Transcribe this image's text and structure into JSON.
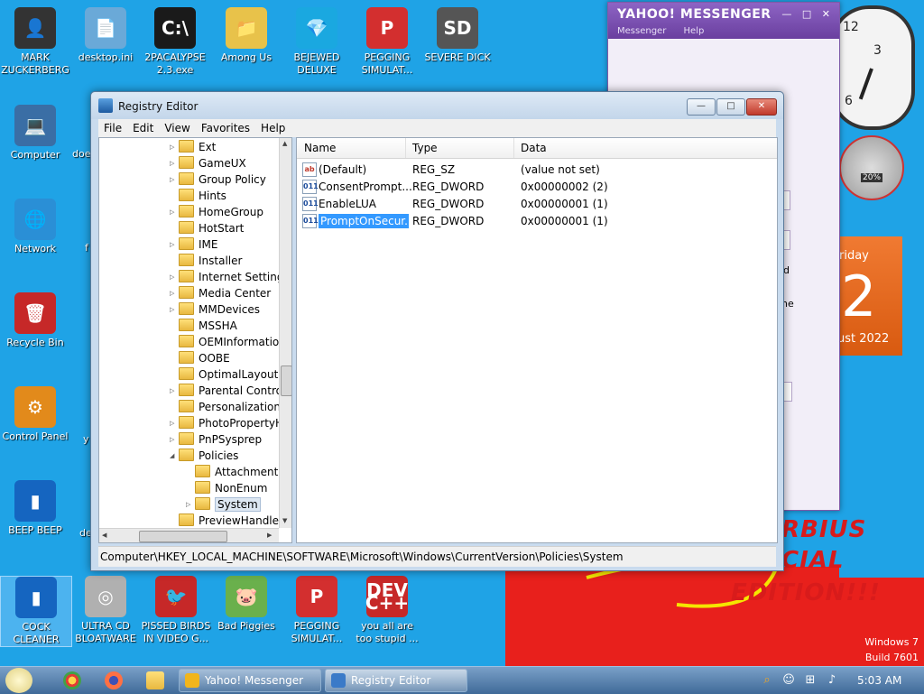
{
  "desktop": {
    "icons_left": [
      {
        "label": "MARK ZUCKERBERG",
        "glyph": "👤",
        "color": "#333333"
      },
      {
        "label": "Computer",
        "glyph": "💻",
        "color": "#3a6ea5"
      },
      {
        "label": "Network",
        "glyph": "🌐",
        "color": "#2a8fd6"
      },
      {
        "label": "Recycle Bin",
        "glyph": "🗑",
        "color": "#c62828"
      },
      {
        "label": "Control Panel",
        "glyph": "⚙",
        "color": "#e28a1b"
      },
      {
        "label": "BEEP BEEP",
        "glyph": "▮",
        "color": "#1565c0"
      },
      {
        "label": "COCK CLEANER",
        "glyph": "▮",
        "color": "#1565c0"
      }
    ],
    "icons_top": [
      {
        "label": "desktop.ini",
        "glyph": "📄",
        "color": "#6aa9d8"
      },
      {
        "label": "2PACALYPSE 2.3.exe",
        "glyph": "C:\\",
        "color": "#1a1a1a"
      },
      {
        "label": "Among Us",
        "glyph": "📁",
        "color": "#e8c24a"
      },
      {
        "label": "BEJEWED DELUXE",
        "glyph": "💎",
        "color": "#1aa8e0"
      },
      {
        "label": "PEGGING SIMULAT...",
        "glyph": "P",
        "color": "#d32f2f"
      },
      {
        "label": "SEVERE DICK",
        "glyph": "SD",
        "color": "#555555"
      }
    ],
    "icons_bottom": [
      {
        "label": "ULTRA CD BLOATWARE",
        "glyph": "◎",
        "color": "#b0b0b0"
      },
      {
        "label": "PISSED BIRDS IN VIDEO G...",
        "glyph": "🐦",
        "color": "#c62828"
      },
      {
        "label": "Bad Piggies",
        "glyph": "🐷",
        "color": "#6ab04c"
      },
      {
        "label": "PEGGING SIMULAT...",
        "glyph": "P",
        "color": "#d32f2f"
      },
      {
        "label": "you all are too stupid ...",
        "glyph": "DEV C++",
        "color": "#c62828"
      }
    ],
    "partial_labels": [
      "doe",
      "f",
      "y",
      "de"
    ],
    "wallpaper_text": [
      "RBIUS",
      "CIAL",
      "EDITION!!!"
    ],
    "windows_version": "Windows 7",
    "build": "Build 7601"
  },
  "yahoo": {
    "brand": "YAHOO! MESSENGER",
    "menu": [
      "Messenger",
      "Help"
    ],
    "side_text": [
      "d",
      "ne"
    ]
  },
  "gadgets": {
    "clock_numbers": [
      "12",
      "3",
      "6"
    ],
    "meter_percent": "20%",
    "calendar_day": "riday",
    "calendar_date": "2",
    "calendar_month": "ust 2022"
  },
  "regedit": {
    "title": "Registry Editor",
    "buttons": {
      "minimize": "—",
      "maximize": "□",
      "close": "✕"
    },
    "menu": [
      "File",
      "Edit",
      "View",
      "Favorites",
      "Help"
    ],
    "tree": [
      {
        "label": "Ext",
        "level": 0,
        "exp": "▷"
      },
      {
        "label": "GameUX",
        "level": 0,
        "exp": "▷"
      },
      {
        "label": "Group Policy",
        "level": 0,
        "exp": "▷"
      },
      {
        "label": "Hints",
        "level": 0,
        "exp": ""
      },
      {
        "label": "HomeGroup",
        "level": 0,
        "exp": "▷"
      },
      {
        "label": "HotStart",
        "level": 0,
        "exp": ""
      },
      {
        "label": "IME",
        "level": 0,
        "exp": "▷"
      },
      {
        "label": "Installer",
        "level": 0,
        "exp": ""
      },
      {
        "label": "Internet Settings",
        "level": 0,
        "exp": "▷"
      },
      {
        "label": "Media Center",
        "level": 0,
        "exp": "▷"
      },
      {
        "label": "MMDevices",
        "level": 0,
        "exp": "▷"
      },
      {
        "label": "MSSHA",
        "level": 0,
        "exp": ""
      },
      {
        "label": "OEMInformation",
        "level": 0,
        "exp": ""
      },
      {
        "label": "OOBE",
        "level": 0,
        "exp": ""
      },
      {
        "label": "OptimalLayout",
        "level": 0,
        "exp": ""
      },
      {
        "label": "Parental Controls",
        "level": 0,
        "exp": "▷"
      },
      {
        "label": "Personalization",
        "level": 0,
        "exp": ""
      },
      {
        "label": "PhotoPropertyHandler",
        "level": 0,
        "exp": "▷"
      },
      {
        "label": "PnPSysprep",
        "level": 0,
        "exp": "▷"
      },
      {
        "label": "Policies",
        "level": 0,
        "exp": "◢"
      },
      {
        "label": "Attachments",
        "level": 1,
        "exp": ""
      },
      {
        "label": "NonEnum",
        "level": 1,
        "exp": ""
      },
      {
        "label": "System",
        "level": 1,
        "exp": "▷",
        "selected": true
      },
      {
        "label": "PreviewHandlers",
        "level": 0,
        "exp": ""
      }
    ],
    "columns": [
      "Name",
      "Type",
      "Data"
    ],
    "values": [
      {
        "icon": "ab",
        "name": "(Default)",
        "type": "REG_SZ",
        "data": "(value not set)"
      },
      {
        "icon": "011",
        "name": "ConsentPrompt...",
        "type": "REG_DWORD",
        "data": "0x00000002 (2)"
      },
      {
        "icon": "011",
        "name": "EnableLUA",
        "type": "REG_DWORD",
        "data": "0x00000001 (1)"
      },
      {
        "icon": "011",
        "name": "PromptOnSecur...",
        "type": "REG_DWORD",
        "data": "0x00000001 (1)",
        "selected": true
      }
    ],
    "status_path": "Computer\\HKEY_LOCAL_MACHINE\\SOFTWARE\\Microsoft\\Windows\\CurrentVersion\\Policies\\System"
  },
  "taskbar": {
    "tasks": [
      {
        "label": "Yahoo! Messenger",
        "color": "#f2b51c"
      },
      {
        "label": "Registry Editor",
        "color": "#3a7ac8",
        "active": true
      }
    ],
    "tray_icons": [
      "search-icon",
      "emoji-icon",
      "network-icon",
      "volume-icon"
    ],
    "time": "5:03 AM"
  },
  "colors": {
    "desktop_bg": "#1fa3e6",
    "selection": "#3399ff",
    "yahoo_purple": "#6a3f9f",
    "calendar_orange": "#e0661a"
  }
}
